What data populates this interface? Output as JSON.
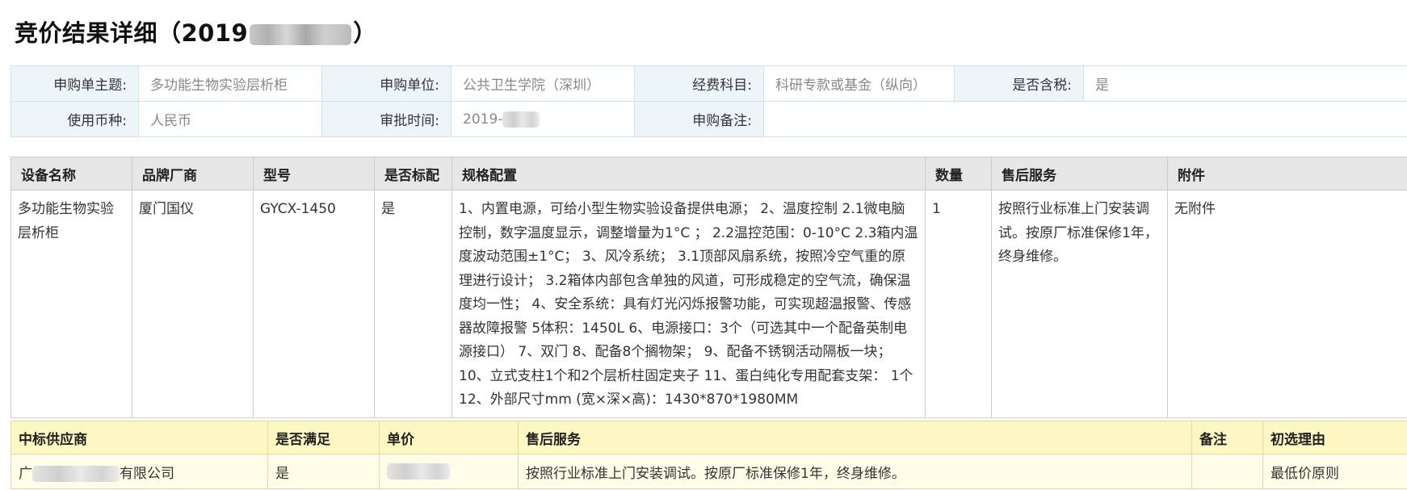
{
  "page": {
    "title_prefix": "竞价结果详细（2019",
    "title_suffix": "）"
  },
  "info": {
    "subject_label": "申购单主题:",
    "subject_value": "多功能生物实验层析柜",
    "unit_label": "申购单位:",
    "unit_value": "公共卫生学院（深圳）",
    "funding_label": "经费科目:",
    "funding_value": "科研专款或基金（纵向）",
    "tax_label": "是否含税:",
    "tax_value": "是",
    "currency_label": "使用币种:",
    "currency_value": "人民币",
    "approval_label": "审批时间:",
    "approval_value": "2019-",
    "remark_label": "申购备注:",
    "remark_value": ""
  },
  "equipment": {
    "headers": [
      "设备名称",
      "品牌厂商",
      "型号",
      "是否标配",
      "规格配置",
      "数量",
      "售后服务",
      "附件"
    ],
    "rows": [
      {
        "name": "多功能生物实验层析柜",
        "brand": "厦门国仪",
        "model": "GYCX-1450",
        "standard": "是",
        "spec": "1、内置电源，可给小型生物实验设备提供电源； 2、温度控制 2.1微电脑控制，数字温度显示，调整增量为1°C ； 2.2温控范围：0-10°C 2.3箱内温度波动范围±1°C； 3、风冷系统； 3.1顶部风扇系统，按照冷空气重的原理进行设计； 3.2箱体内部包含单独的风道，可形成稳定的空气流，确保温度均一性； 4、安全系统：具有灯光闪烁报警功能，可实现超温报警、传感器故障报警 5体积：1450L 6、电源接口：3个（可选其中一个配备英制电源接口） 7、双门 8、配备8个搁物架； 9、配备不锈钢活动隔板一块； 10、立式支柱1个和2个层析柱固定夹子 11、蛋白纯化专用配套支架： 1个 12、外部尺寸mm (宽×深×高)：1430*870*1980MM",
        "quantity": "1",
        "service": "按照行业标准上门安装调试。按原厂标准保修1年，终身维修。",
        "attachment": "无附件"
      }
    ]
  },
  "supplier": {
    "headers": [
      "中标供应商",
      "是否满足",
      "单价",
      "售后服务",
      "备注",
      "初选理由"
    ],
    "rows": [
      {
        "name_prefix": "广",
        "name_suffix": "有限公司",
        "satisfied": "是",
        "price": "",
        "service": "按照行业标准上门安装调试。按原厂标准保修1年，终身维修。",
        "remark": "",
        "reason": "最低价原则"
      }
    ]
  }
}
